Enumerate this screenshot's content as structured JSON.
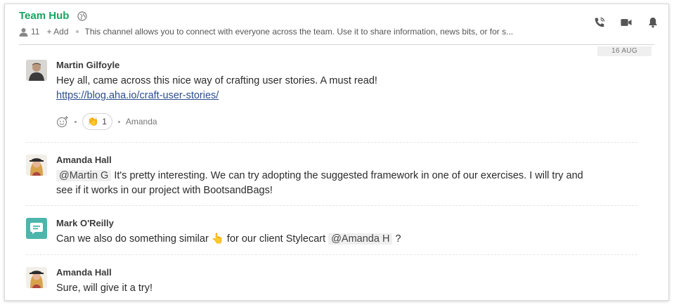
{
  "header": {
    "channel_title": "Team Hub",
    "member_count": "11",
    "add_label": "+ Add",
    "description": "This channel allows you to connect with everyone across the team. Use it to share information, news bits, or for s..."
  },
  "date_label": "16 AUG",
  "colors": {
    "accent": "#1aa260",
    "link": "#2a4d8f",
    "bot_avatar": "#4db6ac"
  },
  "messages": [
    {
      "author": "Martin Gilfoyle",
      "text": "Hey all, came across this nice way of crafting user stories. A must read!",
      "link": "https://blog.aha.io/craft-user-stories/",
      "reaction": {
        "emoji": "👏",
        "count": "1",
        "by": "Amanda"
      }
    },
    {
      "author": "Amanda Hall",
      "mention": "@Martin G",
      "text": "It's pretty interesting. We can try adopting the suggested framework in one of our exercises. I will try and",
      "text2": "see if it works in our project with BootsandBags!"
    },
    {
      "author": "Mark O'Reilly",
      "text_before": "Can we also do something similar",
      "emoji": "👆",
      "text_after": "for our client Stylecart",
      "mention": "@Amanda H",
      "text_end": "?"
    },
    {
      "author": "Amanda Hall",
      "text": "Sure, will give it a try!"
    }
  ],
  "icons": [
    "globe-icon",
    "members-icon",
    "phone-icon",
    "video-icon",
    "bell-icon",
    "add-reaction-icon"
  ]
}
